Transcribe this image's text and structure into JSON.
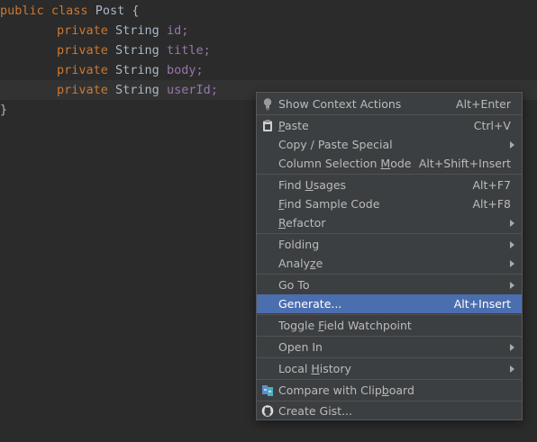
{
  "editor": {
    "line1": {
      "kw1": "public",
      "kw2": "class",
      "name": "Post",
      "brace": "{"
    },
    "fields": [
      {
        "kw": "private",
        "type": "String",
        "name": "id;"
      },
      {
        "kw": "private",
        "type": "String",
        "name": "title;"
      },
      {
        "kw": "private",
        "type": "String",
        "name": "body;"
      },
      {
        "kw": "private",
        "type": "String",
        "name": "userId;"
      }
    ],
    "closing": "}"
  },
  "menu": {
    "items": [
      {
        "pre": "Show Context Actions",
        "u": "",
        "post": "",
        "shortcut": "Alt+Enter",
        "icon": "lightbulb-icon"
      },
      {
        "pre": "",
        "u": "P",
        "post": "aste",
        "shortcut": "Ctrl+V",
        "icon": "clipboard-icon"
      },
      {
        "pre": "Copy / Paste Special",
        "u": "",
        "post": "",
        "shortcut": "",
        "submenu": true
      },
      {
        "pre": "Column Selection ",
        "u": "M",
        "post": "ode",
        "shortcut": "Alt+Shift+Insert"
      },
      {
        "pre": "Find ",
        "u": "U",
        "post": "sages",
        "shortcut": "Alt+F7"
      },
      {
        "pre": "",
        "u": "F",
        "post": "ind Sample Code",
        "shortcut": "Alt+F8"
      },
      {
        "pre": "",
        "u": "R",
        "post": "efactor",
        "shortcut": "",
        "submenu": true
      },
      {
        "pre": "Folding",
        "u": "",
        "post": "",
        "shortcut": "",
        "submenu": true
      },
      {
        "pre": "Analy",
        "u": "z",
        "post": "e",
        "shortcut": "",
        "submenu": true
      },
      {
        "pre": "Go To",
        "u": "",
        "post": "",
        "shortcut": "",
        "submenu": true
      },
      {
        "pre": "Generate...",
        "u": "",
        "post": "",
        "shortcut": "Alt+Insert",
        "selected": true
      },
      {
        "pre": "Toggle ",
        "u": "F",
        "post": "ield Watchpoint",
        "shortcut": ""
      },
      {
        "pre": "Open In",
        "u": "",
        "post": "",
        "shortcut": "",
        "submenu": true
      },
      {
        "pre": "Local ",
        "u": "H",
        "post": "istory",
        "shortcut": "",
        "submenu": true
      },
      {
        "pre": "Compare with Clip",
        "u": "b",
        "post": "oard",
        "shortcut": "",
        "icon": "compare-clipboard-icon"
      },
      {
        "pre": "Create Gist...",
        "u": "",
        "post": "",
        "shortcut": "",
        "icon": "github-icon"
      }
    ]
  },
  "colors": {
    "background": "#2b2b2b",
    "keyword": "#cc7832",
    "field": "#9876aa",
    "text": "#a9b7c6",
    "menu_bg": "#3c3f41",
    "selection": "#4b6eaf"
  }
}
